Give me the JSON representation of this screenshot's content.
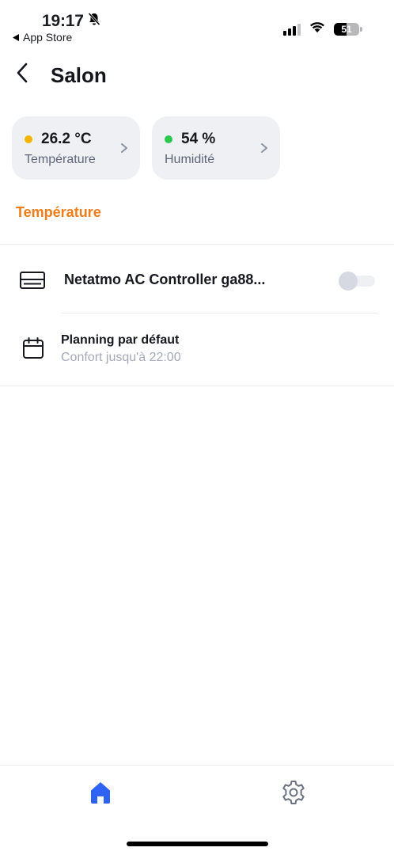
{
  "status_bar": {
    "time": "19:17",
    "back_link": "App Store",
    "battery_level": "51",
    "icons": [
      "bell-slash-icon",
      "signal-icon",
      "wifi-icon",
      "battery-icon"
    ]
  },
  "header": {
    "title": "Salon",
    "back_icon": "chevron-left-icon"
  },
  "sensors": [
    {
      "value": "26.2 °C",
      "label": "Température",
      "status_color": "#f5b400"
    },
    {
      "value": "54 %",
      "label": "Humidité",
      "status_color": "#2ec850"
    }
  ],
  "section": {
    "title": "Température",
    "accent_color": "#f07d1a"
  },
  "device": {
    "name": "Netatmo AC Controller ga88...",
    "icon": "air-conditioner-icon",
    "toggle_on": false
  },
  "schedule": {
    "title": "Planning par défaut",
    "subtitle": "Confort jusqu'à 22:00",
    "icon": "calendar-icon"
  },
  "bottom_nav": {
    "items": [
      {
        "name": "home",
        "icon": "home-icon",
        "active": true,
        "color": "#2f63f6"
      },
      {
        "name": "settings",
        "icon": "gear-icon",
        "active": false,
        "color": "#6b7180"
      }
    ]
  }
}
